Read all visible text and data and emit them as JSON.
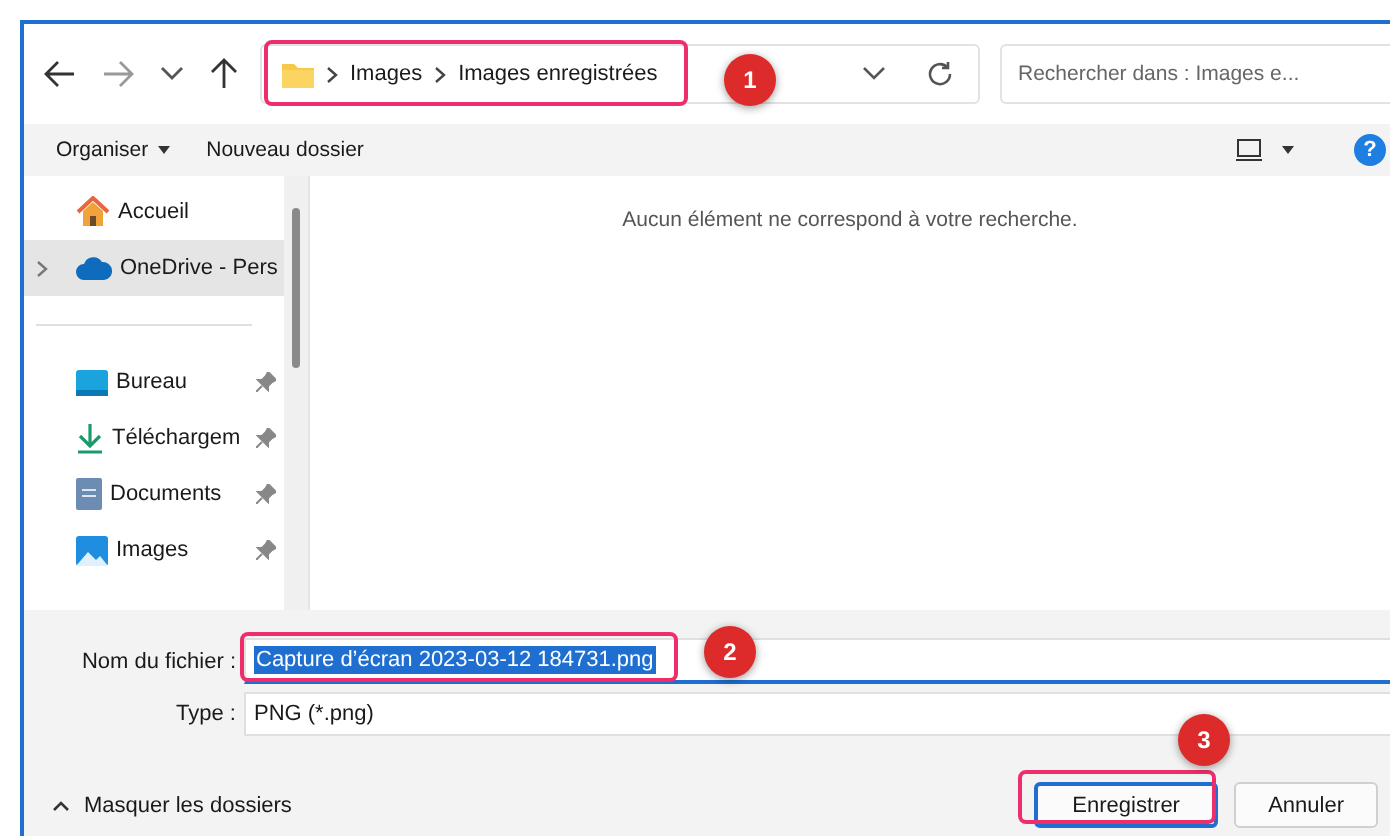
{
  "navigation": {
    "breadcrumb": [
      "Images",
      "Images enregistrées"
    ],
    "search": {
      "placeholder": "Rechercher dans : Images e..."
    }
  },
  "toolbar": {
    "organize": "Organiser",
    "new_folder": "Nouveau dossier",
    "help": "?"
  },
  "sidebar": {
    "items": [
      {
        "label": "Accueil",
        "kind": "home",
        "selected": false,
        "expandable": false,
        "pinned": false
      },
      {
        "label": "OneDrive - Pers",
        "kind": "cloud",
        "selected": true,
        "expandable": true,
        "pinned": false
      },
      {
        "kind": "separator"
      },
      {
        "label": "Bureau",
        "kind": "desktop",
        "selected": false,
        "expandable": false,
        "pinned": true
      },
      {
        "label": "Téléchargem",
        "kind": "download",
        "selected": false,
        "expandable": false,
        "pinned": true
      },
      {
        "label": "Documents",
        "kind": "documents",
        "selected": false,
        "expandable": false,
        "pinned": true
      },
      {
        "label": "Images",
        "kind": "pictures",
        "selected": false,
        "expandable": false,
        "pinned": true
      }
    ]
  },
  "content": {
    "empty_message": "Aucun élément ne correspond à votre recherche."
  },
  "form": {
    "filename": {
      "label": "Nom du fichier :",
      "value": "Capture d’écran 2023-03-12 184731.png"
    },
    "type": {
      "label": "Type :",
      "value": "PNG (*.png)"
    }
  },
  "footer": {
    "hide_folders": "Masquer les dossiers",
    "buttons": [
      {
        "label": "Enregistrer",
        "kind": "primary"
      },
      {
        "label": "Annuler",
        "kind": "secondary"
      }
    ]
  },
  "annotations": [
    "1",
    "2",
    "3"
  ]
}
